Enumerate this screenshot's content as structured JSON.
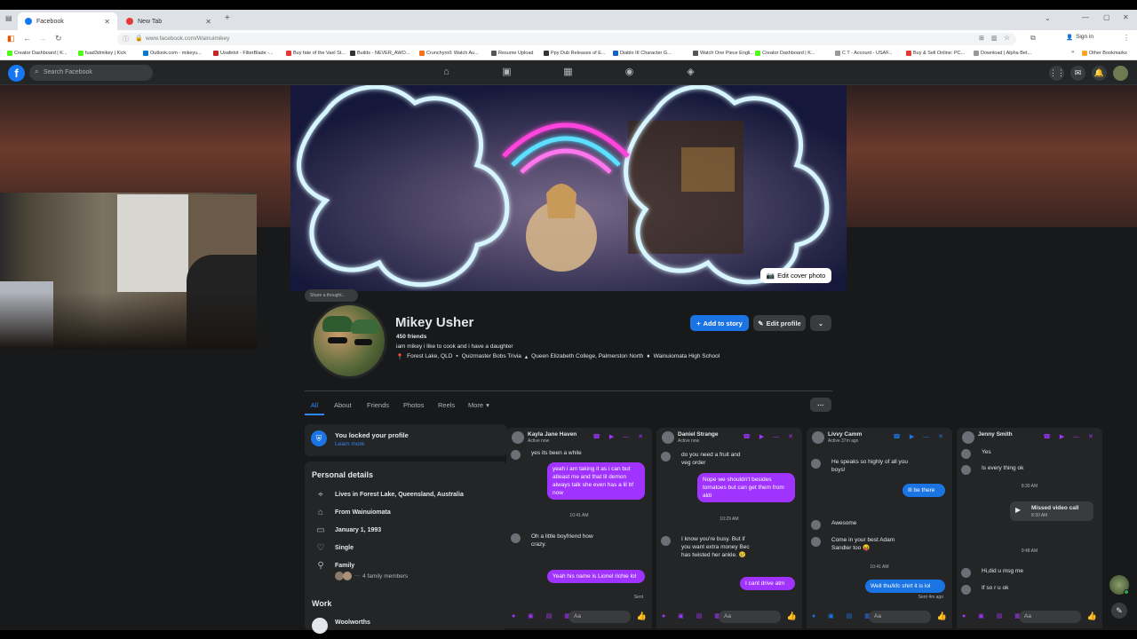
{
  "browser": {
    "tabs": [
      {
        "label": "Facebook"
      },
      {
        "label": "New Tab"
      }
    ],
    "url": "www.facebook.com/Wainuimikey",
    "signin": "Sign in",
    "bookmarks": [
      {
        "label": "Creator Dashboard | K...",
        "color": "#53fc18"
      },
      {
        "label": "fuad3dmikey | Kick",
        "color": "#53fc18"
      },
      {
        "label": "Outlook.com - mikeyu...",
        "color": "#0078d4"
      },
      {
        "label": "Usafetot - FilterBlade -...",
        "color": "#c62828"
      },
      {
        "label": "Buy fate of the Vael St...",
        "color": "#e53935"
      },
      {
        "label": "Builds - NEVER_AWO...",
        "color": "#333333"
      },
      {
        "label": "Crunchyroll: Watch Au...",
        "color": "#f47521"
      },
      {
        "label": "Resume Upload",
        "color": "#555555"
      },
      {
        "label": "Ppy Dub Releases of E...",
        "color": "#333333"
      },
      {
        "label": "Diablo III Character G...",
        "color": "#1565c0"
      },
      {
        "label": "Watch One Piece Engli...",
        "color": "#555555"
      },
      {
        "label": "Creator Dashboard | K...",
        "color": "#53fc18"
      },
      {
        "label": "C T - Account - USAF...",
        "color": "#999999"
      },
      {
        "label": "Buy & Sell Online: PC...",
        "color": "#e53935"
      },
      {
        "label": "Download | Alpha Bet...",
        "color": "#999999"
      }
    ],
    "other_bookmarks": "Other Bookmarks"
  },
  "fb": {
    "search_placeholder": "Search Facebook",
    "nav_icons": [
      "home-icon",
      "video-icon",
      "marketplace-icon",
      "groups-icon",
      "gaming-icon"
    ],
    "right_icons": [
      "menu-grid-icon",
      "messenger-icon",
      "bell-icon",
      "profile-avatar"
    ]
  },
  "profile": {
    "edit_cover": "Edit cover photo",
    "thought": "Share a thought...",
    "name": "Mikey Usher",
    "friends": "450 friends",
    "bio": "iam mikey i like to cook and i have a daughter",
    "details_line": [
      "Forest Lake, QLD",
      "Quizmaster Bobs Trivia",
      "Queen Elizabeth College, Palmerston North",
      "Wainuiomata High School"
    ],
    "add_story": "Add to story",
    "edit_profile": "Edit profile",
    "tabs": [
      "All",
      "About",
      "Friends",
      "Photos",
      "Reels",
      "More"
    ],
    "more_dots": "···"
  },
  "intro": {
    "locked_title": "You locked your profile",
    "learn_more": "Learn more",
    "personal_details": "Personal details",
    "details": [
      {
        "icon": "location-icon",
        "text": "Lives in Forest Lake, Queensland, Australia"
      },
      {
        "icon": "home-icon",
        "text": "From Wainuiomata"
      },
      {
        "icon": "birthday-icon",
        "text": "January 1, 1993"
      },
      {
        "icon": "relationship-icon",
        "text": "Single"
      },
      {
        "icon": "family-icon",
        "text": "Family"
      }
    ],
    "family_members": "4 family members",
    "work_title": "Work",
    "work_place": "Woolworths"
  },
  "chats": [
    {
      "name": "Kayla Jane Haven",
      "status": "Active now",
      "accent": "#a033ff",
      "messages": [
        {
          "dir": "in",
          "text": "yes its been a while"
        },
        {
          "dir": "out",
          "text": "yeah i am taking it as i can but atleast me and that lil demon always talk she even has a lil bf now"
        },
        {
          "dir": "time",
          "text": "10:41 AM"
        },
        {
          "dir": "in",
          "text": "Oh a little boyfriend how crazy."
        },
        {
          "dir": "out",
          "text": "Yeah his name is Lionel richie lol"
        },
        {
          "dir": "time",
          "text": "Sent"
        }
      ],
      "input": "Aa"
    },
    {
      "name": "Daniel Strange",
      "status": "Active now",
      "accent": "#a033ff",
      "messages": [
        {
          "dir": "in",
          "text": "do you need a fruit and veg order"
        },
        {
          "dir": "out",
          "text": "Nope we shouldn't besides tomatoes but can get them from aldi"
        },
        {
          "dir": "time",
          "text": "10:29 AM"
        },
        {
          "dir": "in",
          "text": "I know you're busy. But if you want extra money Bec has twisted her ankle. 😢"
        },
        {
          "dir": "out",
          "text": "I cant drive atm"
        }
      ],
      "input": "Aa"
    },
    {
      "name": "Livvy Camm",
      "status": "Active 37m ago",
      "accent": "#1b74e4",
      "messages": [
        {
          "dir": "in",
          "text": "He speaks so highly of all you boys!"
        },
        {
          "dir": "out",
          "text": "Ill be there"
        },
        {
          "dir": "in",
          "text": "Awesome"
        },
        {
          "dir": "in",
          "text": "Come in your best Adam Sandler too 😝"
        },
        {
          "dir": "time",
          "text": "10:41 AM"
        },
        {
          "dir": "out",
          "text": "Well thu/kfc shirt it is lol"
        },
        {
          "dir": "time",
          "text": "Sent 4m ago"
        }
      ],
      "input": "Aa"
    },
    {
      "name": "Jenny Smith",
      "status": "",
      "accent": "#a033ff",
      "messages": [
        {
          "dir": "in",
          "text": "Yes"
        },
        {
          "dir": "in",
          "text": "Is every thing ok"
        },
        {
          "dir": "time",
          "text": "8:30 AM"
        },
        {
          "dir": "call",
          "text": "Missed video call",
          "sub": "8:30 AM"
        },
        {
          "dir": "time",
          "text": "9:48 AM"
        },
        {
          "dir": "in",
          "text": "Hi,did u msg me"
        },
        {
          "dir": "in",
          "text": "If so r u ok"
        }
      ],
      "input": "Aa"
    }
  ]
}
